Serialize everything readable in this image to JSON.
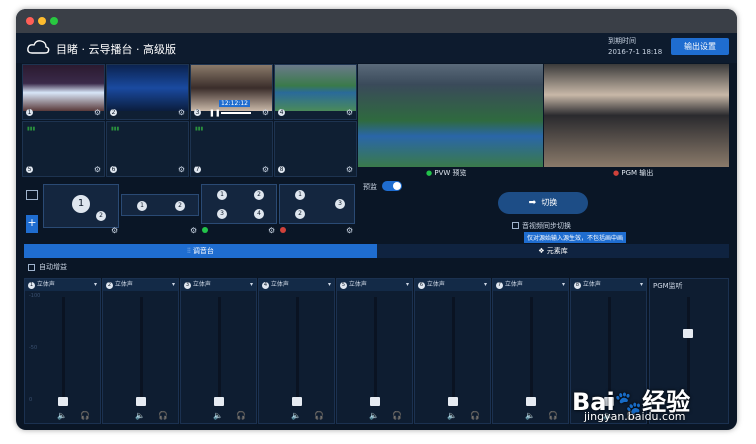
{
  "app": {
    "title": "目睹 · 云导播台 · 高级版",
    "expiry_label": "到期时间",
    "expiry_date": "2016-7-1 18:18",
    "output_settings": "输出设置"
  },
  "sources": [
    {
      "num": "1"
    },
    {
      "num": "2"
    },
    {
      "num": "3",
      "timecode": "12:12:12"
    },
    {
      "num": "4"
    },
    {
      "num": "5"
    },
    {
      "num": "6"
    },
    {
      "num": "7"
    },
    {
      "num": "8"
    }
  ],
  "preview": {
    "pvw_label": "PVW 预览",
    "pgm_label": "PGM 输出"
  },
  "controls": {
    "preview_toggle": "预监",
    "switch": "切换",
    "audio_sync": "音视频同步切换",
    "audio_sync_note": "仅对源始输入源生效，不包括画中画"
  },
  "layouts": [
    "1",
    "2",
    "1",
    "2",
    "1",
    "2",
    "3",
    "4",
    "1",
    "2",
    "3"
  ],
  "tabs": {
    "mixer": "调音台",
    "library": "元素库"
  },
  "mixer": {
    "auto_gain": "自动增益",
    "channels": [
      {
        "num": "1",
        "mode": "立体声"
      },
      {
        "num": "2",
        "mode": "立体声"
      },
      {
        "num": "3",
        "mode": "立体声"
      },
      {
        "num": "4",
        "mode": "立体声"
      },
      {
        "num": "5",
        "mode": "立体声"
      },
      {
        "num": "6",
        "mode": "立体声"
      },
      {
        "num": "7",
        "mode": "立体声"
      },
      {
        "num": "8",
        "mode": "立体声"
      }
    ],
    "pgm_monitor": "PGM监听",
    "scale": [
      "-100",
      "-50",
      "0"
    ]
  },
  "watermark": {
    "brand": "Bai",
    "brand2": "经验",
    "url": "jingyan.baidu.com"
  }
}
